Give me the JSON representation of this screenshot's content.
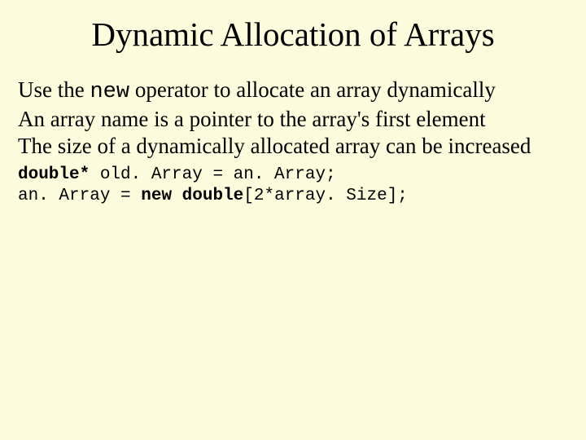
{
  "title": "Dynamic Allocation of Arrays",
  "paragraphs": {
    "line1_a": "Use the ",
    "line1_mono": "new",
    "line1_b": " operator to allocate an array dynamically",
    "line2": "An array name is a pointer to the array's first element",
    "line3": "The size of a dynamically allocated array can be increased"
  },
  "code": {
    "kw1": "double*",
    "l1_rest": " old. Array = an. Array;",
    "l2_a": "an. Array = ",
    "kw2": "new",
    "l2_b": " ",
    "kw3": "double",
    "l2_c": "[2*array. Size];"
  }
}
